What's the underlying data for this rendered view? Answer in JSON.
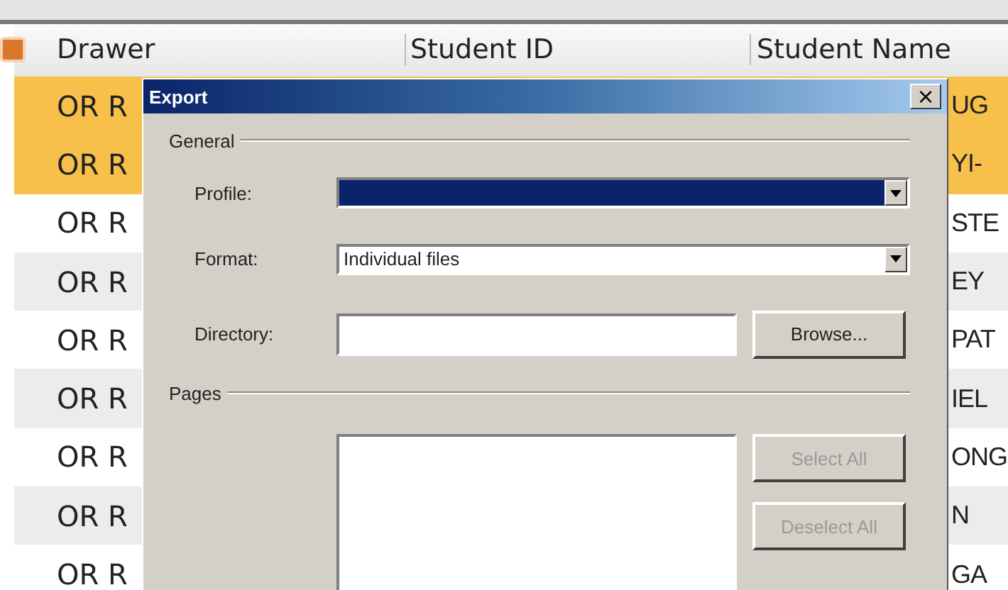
{
  "table": {
    "columns": [
      "Drawer",
      "Student ID",
      "Student Name"
    ],
    "rows": [
      {
        "drawer": "OR R",
        "name": "UG",
        "selected": true
      },
      {
        "drawer": "OR R",
        "name": "YI-",
        "selected": true
      },
      {
        "drawer": "OR R",
        "name": "STE",
        "selected": false
      },
      {
        "drawer": "OR R",
        "name": "EY",
        "selected": false
      },
      {
        "drawer": "OR R",
        "name": "PAT",
        "selected": false
      },
      {
        "drawer": "OR R",
        "name": "IEL",
        "selected": false
      },
      {
        "drawer": "OR R",
        "name": "ONG",
        "selected": false
      },
      {
        "drawer": "OR R",
        "name": "N",
        "selected": false
      },
      {
        "drawer": "OR R",
        "name": "GA",
        "selected": false
      }
    ]
  },
  "dialog": {
    "title": "Export",
    "close": "×",
    "general": {
      "heading": "General",
      "profile": {
        "label": "Profile:",
        "focused": true
      },
      "format": {
        "label": "Format:",
        "value": "Individual files",
        "focused": false
      },
      "directory": {
        "label": "Directory:"
      },
      "browse": {
        "label": "Browse...",
        "disabled": false
      }
    },
    "pages": {
      "heading": "Pages",
      "buttons": [
        {
          "label": "Select All",
          "disabled": true
        },
        {
          "label": "Deselect All",
          "disabled": true
        }
      ]
    }
  }
}
